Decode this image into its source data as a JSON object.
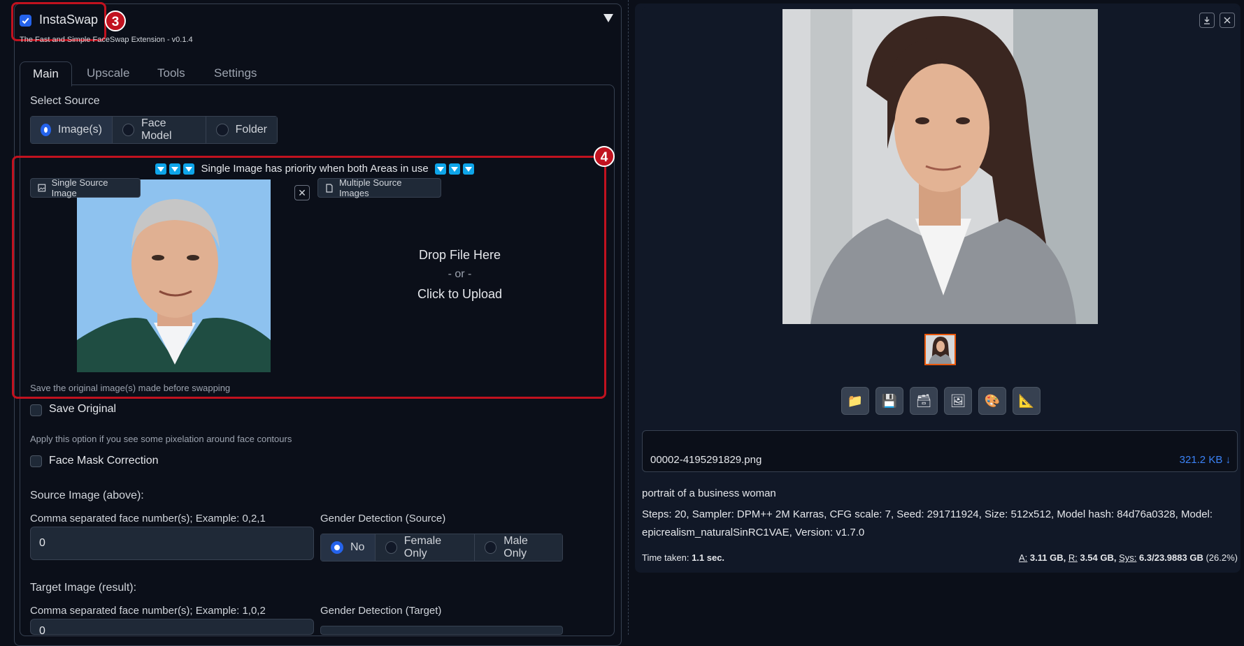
{
  "annotations": {
    "badge_3": "3",
    "badge_4": "4"
  },
  "extension": {
    "enabled": true,
    "title": "InstaSwap",
    "subtitle": "The Fast and Simple FaceSwap Extension - v0.1.4",
    "collapse_icon": "triangle-down-icon"
  },
  "tabs": [
    {
      "label": "Main",
      "active": true
    },
    {
      "label": "Upscale",
      "active": false
    },
    {
      "label": "Tools",
      "active": false
    },
    {
      "label": "Settings",
      "active": false
    }
  ],
  "source": {
    "label": "Select Source",
    "options": [
      "Image(s)",
      "Face Model",
      "Folder"
    ],
    "selected": "Image(s)"
  },
  "priority_note": "Single Image has priority when both Areas in use",
  "single_image": {
    "label": "Single Source Image",
    "close": "✕"
  },
  "multiple_images": {
    "label": "Multiple Source Images",
    "drop": "Drop File Here",
    "or": "- or -",
    "click": "Click to Upload"
  },
  "save_original": {
    "info": "Save the original image(s) made before swapping",
    "label": "Save Original",
    "checked": false
  },
  "face_mask": {
    "info": "Apply this option if you see some pixelation around face contours",
    "label": "Face Mask Correction",
    "checked": false
  },
  "source_image": {
    "heading": "Source Image (above):",
    "faces_label": "Comma separated face number(s); Example: 0,2,1",
    "faces_value": "0",
    "gender_label": "Gender Detection (Source)",
    "gender_options": [
      "No",
      "Female Only",
      "Male Only"
    ],
    "gender_selected": "No"
  },
  "target_image": {
    "heading": "Target Image (result):",
    "faces_label": "Comma separated face number(s); Example: 1,0,2",
    "faces_value": "0",
    "gender_label": "Gender Detection (Target)"
  },
  "output": {
    "tools": [
      "folder-icon",
      "save-icon",
      "zip-icon",
      "image-icon",
      "palette-icon",
      "ruler-icon"
    ],
    "tool_glyphs": [
      "📁",
      "💾",
      "🗃",
      "🖼",
      "🎨",
      "📐"
    ],
    "filename": "00002-4195291829.png",
    "filesize": "321.2 KB ↓",
    "prompt": "portrait of a business woman",
    "params": "Steps: 20, Sampler: DPM++ 2M Karras, CFG scale: 7, Seed: 291711924, Size: 512x512, Model hash: 84d76a0328, Model: epicrealism_naturalSinRC1VAE, Version: v1.7.0",
    "time_label": "Time taken:",
    "time_value": "1.1 sec.",
    "mem_a_label": "A:",
    "mem_a": "3.11 GB,",
    "mem_r_label": "R:",
    "mem_r": "3.54 GB,",
    "mem_sys_label": "Sys:",
    "mem_sys": "6.3/23.9883 GB",
    "mem_pct": "(26.2%)"
  }
}
